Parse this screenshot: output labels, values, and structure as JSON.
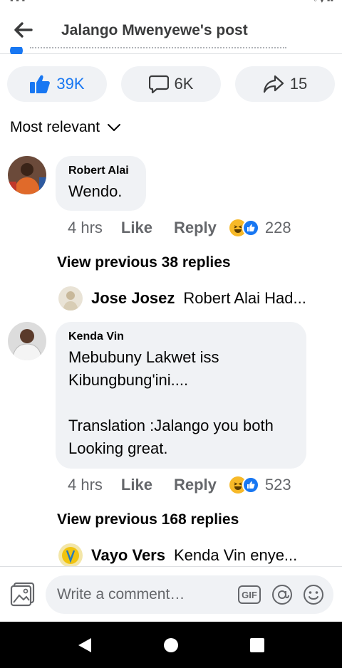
{
  "header": {
    "title": "Jalango Mwenyewe's post"
  },
  "reactions_bar": {
    "likes": "39K",
    "comments": "6K",
    "shares": "15"
  },
  "sort": {
    "label": "Most relevant"
  },
  "comments": [
    {
      "author": "Robert Alai",
      "text": "Wendo.",
      "time": "4 hrs",
      "like_label": "Like",
      "reply_label": "Reply",
      "reaction_count": "228",
      "view_previous": "View previous 38 replies",
      "reply_preview": {
        "name": "Jose Josez",
        "text": "Robert Alai Had..."
      }
    },
    {
      "author": "Kenda Vin",
      "text": "Mebubuny Lakwet iss\nKibungbung'ini....\n\nTranslation :Jalango you both\nLooking great.",
      "time": "4 hrs",
      "like_label": "Like",
      "reply_label": "Reply",
      "reaction_count": "523",
      "view_previous": "View previous 168 replies",
      "reply_preview": {
        "name": "Vayo Vers",
        "text": "Kenda Vin enye..."
      }
    }
  ],
  "composer": {
    "placeholder": "Write a comment…",
    "gif_label": "GIF"
  },
  "colors": {
    "accent": "#1877f2",
    "bubble": "#f0f2f5",
    "secondary_text": "#65676b"
  }
}
